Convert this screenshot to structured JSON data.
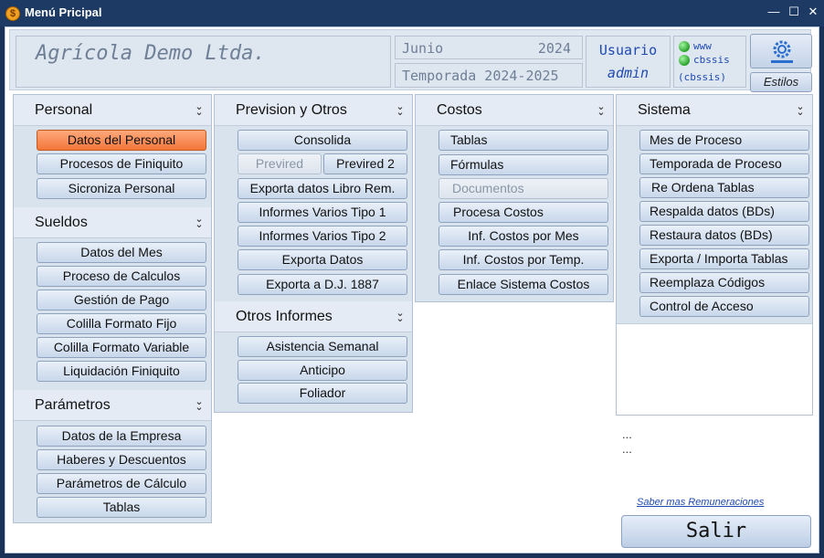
{
  "window": {
    "title": "Menú Pricipal",
    "app_icon_glyph": "$",
    "minimize_glyph": "—",
    "maximize_glyph": "☐",
    "close_glyph": "✕"
  },
  "header": {
    "company": "Agrícola Demo Ltda.",
    "month": "Junio",
    "year": "2024",
    "season": "Temporada 2024-2025",
    "user_label": "Usuario",
    "user_value": "admin",
    "status": {
      "www": "www",
      "cbssis": "cbssis",
      "cbssis_paren": "(cbssis)"
    },
    "estilos": "Estilos"
  },
  "columns": {
    "personal": {
      "title": "Personal",
      "items": [
        "Datos del Personal",
        "Procesos de Finiquito",
        "Sicroniza Personal"
      ]
    },
    "sueldos": {
      "title": "Sueldos",
      "items": [
        "Datos del Mes",
        "Proceso de Calculos",
        "Gestión de Pago",
        "Colilla Formato Fijo",
        "Colilla Formato Variable",
        "Liquidación Finiquito"
      ]
    },
    "parametros": {
      "title": "Parámetros",
      "items": [
        "Datos de la Empresa",
        "Haberes y Descuentos",
        "Parámetros de Cálculo",
        "Tablas"
      ]
    },
    "prevision": {
      "title": "Prevision y Otros",
      "consolida": "Consolida",
      "previred": "Previred",
      "previred2": "Previred 2",
      "items": [
        "Exporta datos Libro Rem.",
        "Informes Varios Tipo 1",
        "Informes Varios Tipo 2",
        "Exporta Datos",
        "Exporta a D.J. 1887"
      ]
    },
    "otros": {
      "title": "Otros Informes",
      "items": [
        "Asistencia Semanal",
        "Anticipo",
        "Foliador"
      ]
    },
    "costos": {
      "title": "Costos",
      "items": [
        "Tablas",
        "Fórmulas",
        "Documentos",
        "Procesa  Costos",
        "Inf. Costos por Mes",
        "Inf. Costos por Temp.",
        "Enlace Sistema Costos"
      ]
    },
    "sistema": {
      "title": "Sistema",
      "items": [
        "Mes de Proceso",
        "Temporada de Proceso",
        "Re Ordena Tablas",
        "Respalda datos  (BDs)",
        "Restaura datos  (BDs)",
        "Exporta / Importa Tablas",
        "Reemplaza Códigos",
        "Control de Acceso"
      ]
    }
  },
  "footer": {
    "dots1": "...",
    "dots2": "...",
    "link": "Saber mas Remuneraciones",
    "exit": "Salir"
  }
}
